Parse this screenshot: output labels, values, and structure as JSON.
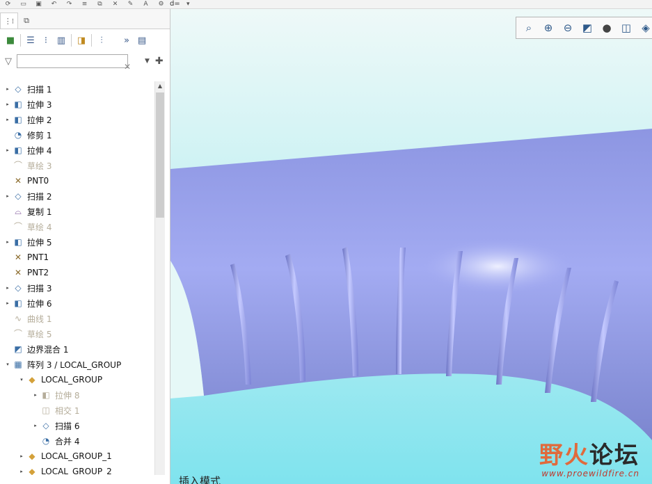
{
  "quick_toolbar": {
    "relation_label": "d="
  },
  "tree": {
    "filter_placeholder": "",
    "items": [
      {
        "label": "扫描 1",
        "icon": "sweep-icon",
        "glyph": "◇",
        "expander": "▸",
        "indent": 0,
        "suppressed": false
      },
      {
        "label": "拉伸 3",
        "icon": "extrude-icon",
        "glyph": "◧",
        "expander": "▸",
        "indent": 0,
        "suppressed": false
      },
      {
        "label": "拉伸 2",
        "icon": "extrude-icon",
        "glyph": "◧",
        "expander": "▸",
        "indent": 0,
        "suppressed": false
      },
      {
        "label": "修剪 1",
        "icon": "trim-icon",
        "glyph": "◔",
        "expander": "",
        "indent": 0,
        "suppressed": false
      },
      {
        "label": "拉伸 4",
        "icon": "extrude-icon",
        "glyph": "◧",
        "expander": "▸",
        "indent": 0,
        "suppressed": false
      },
      {
        "label": "草绘 3",
        "icon": "sketch-icon",
        "glyph": "⌒",
        "expander": "",
        "indent": 0,
        "suppressed": true
      },
      {
        "label": "PNT0",
        "icon": "datum-point-icon",
        "glyph": "✕",
        "expander": "",
        "indent": 0,
        "suppressed": false
      },
      {
        "label": "扫描 2",
        "icon": "sweep-icon",
        "glyph": "◇",
        "expander": "▸",
        "indent": 0,
        "suppressed": false
      },
      {
        "label": "复制 1",
        "icon": "copy-icon",
        "glyph": "⌓",
        "expander": "",
        "indent": 0,
        "suppressed": false
      },
      {
        "label": "草绘 4",
        "icon": "sketch-icon",
        "glyph": "⌒",
        "expander": "",
        "indent": 0,
        "suppressed": true
      },
      {
        "label": "拉伸 5",
        "icon": "extrude-icon",
        "glyph": "◧",
        "expander": "▸",
        "indent": 0,
        "suppressed": false
      },
      {
        "label": "PNT1",
        "icon": "datum-point-icon",
        "glyph": "✕",
        "expander": "",
        "indent": 0,
        "suppressed": false
      },
      {
        "label": "PNT2",
        "icon": "datum-point-icon",
        "glyph": "✕",
        "expander": "",
        "indent": 0,
        "suppressed": false
      },
      {
        "label": "扫描 3",
        "icon": "sweep-icon",
        "glyph": "◇",
        "expander": "▸",
        "indent": 0,
        "suppressed": false
      },
      {
        "label": "拉伸 6",
        "icon": "extrude-icon",
        "glyph": "◧",
        "expander": "▸",
        "indent": 0,
        "suppressed": false
      },
      {
        "label": "曲线 1",
        "icon": "curve-icon",
        "glyph": "∿",
        "expander": "",
        "indent": 0,
        "suppressed": true
      },
      {
        "label": "草绘 5",
        "icon": "sketch-icon",
        "glyph": "⌒",
        "expander": "",
        "indent": 0,
        "suppressed": true
      },
      {
        "label": "边界混合 1",
        "icon": "boundary-blend-icon",
        "glyph": "◩",
        "expander": "",
        "indent": 0,
        "suppressed": false
      },
      {
        "label": "阵列 3 / LOCAL_GROUP",
        "icon": "pattern-icon",
        "glyph": "▦",
        "expander": "▾",
        "indent": 0,
        "suppressed": false
      },
      {
        "label": "LOCAL_GROUP",
        "icon": "group-icon",
        "glyph": "◆",
        "expander": "▾",
        "indent": 1,
        "suppressed": false
      },
      {
        "label": "拉伸 8",
        "icon": "extrude-icon",
        "glyph": "◧",
        "expander": "▸",
        "indent": 2,
        "suppressed": true
      },
      {
        "label": "相交 1",
        "icon": "intersect-icon",
        "glyph": "◫",
        "expander": "",
        "indent": 2,
        "suppressed": true
      },
      {
        "label": "扫描 6",
        "icon": "sweep-icon",
        "glyph": "◇",
        "expander": "▸",
        "indent": 2,
        "suppressed": false
      },
      {
        "label": "合并 4",
        "icon": "merge-icon",
        "glyph": "◔",
        "expander": "",
        "indent": 2,
        "suppressed": false
      },
      {
        "label": "LOCAL_GROUP_1",
        "icon": "group-icon",
        "glyph": "◆",
        "expander": "▸",
        "indent": 1,
        "suppressed": false
      },
      {
        "label": "LOCAL_GROUP_2",
        "icon": "group-icon",
        "glyph": "◆",
        "expander": "▸",
        "indent": 1,
        "suppressed": false
      }
    ]
  },
  "viewport": {
    "mode_text": "插入模式",
    "model_color": "#9aa4ec",
    "background_top": "#e6f8f7",
    "background_bottom": "#7fe3ee"
  },
  "watermark": {
    "brand_part1": "野火",
    "brand_part2": "论坛",
    "url": "www.proewildfire.cn"
  }
}
